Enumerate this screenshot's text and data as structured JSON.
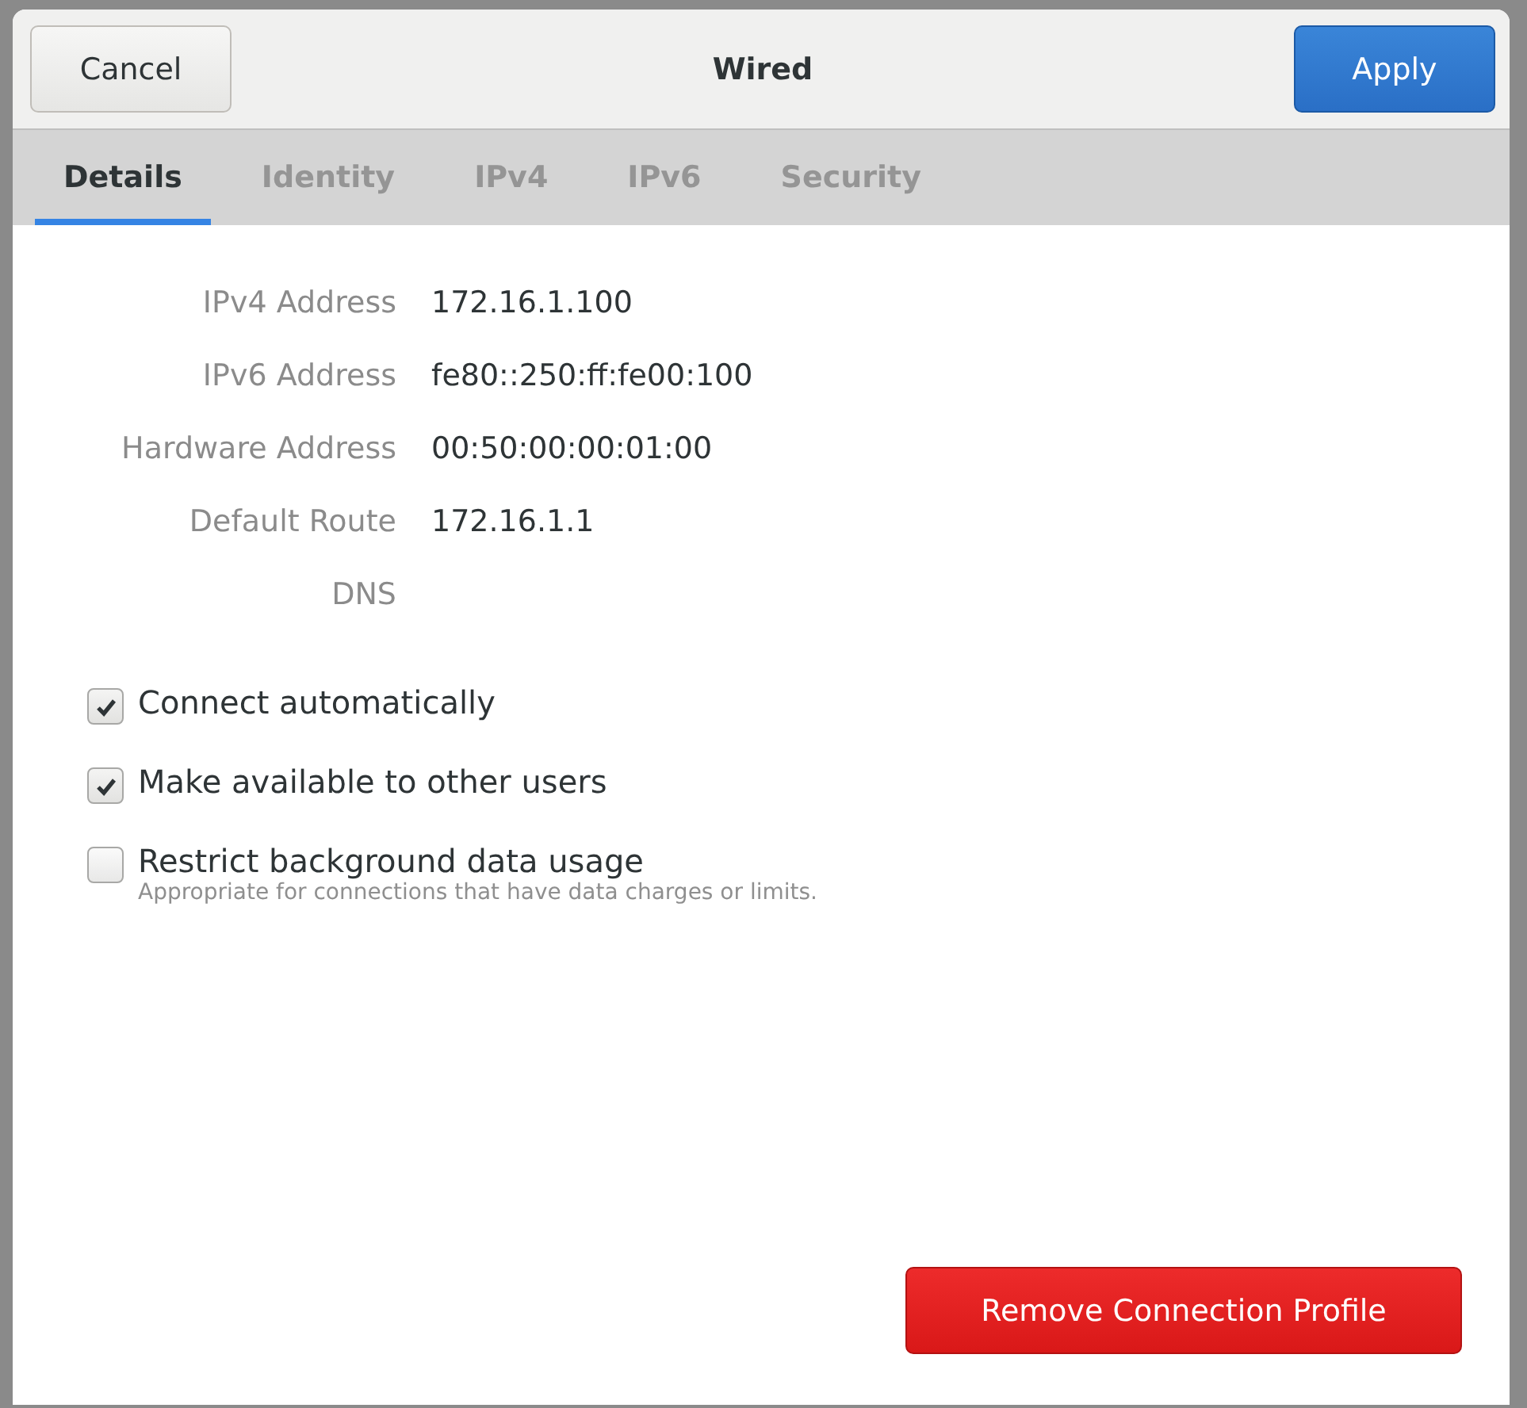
{
  "header": {
    "cancel": "Cancel",
    "title": "Wired",
    "apply": "Apply"
  },
  "tabs": [
    {
      "label": "Details",
      "selected": true
    },
    {
      "label": "Identity",
      "selected": false
    },
    {
      "label": "IPv4",
      "selected": false
    },
    {
      "label": "IPv6",
      "selected": false
    },
    {
      "label": "Security",
      "selected": false
    }
  ],
  "details": [
    {
      "label": "IPv4 Address",
      "value": "172.16.1.100"
    },
    {
      "label": "IPv6 Address",
      "value": "fe80::250:ff:fe00:100"
    },
    {
      "label": "Hardware Address",
      "value": "00:50:00:00:01:00"
    },
    {
      "label": "Default Route",
      "value": "172.16.1.1"
    },
    {
      "label": "DNS"
    }
  ],
  "options": [
    {
      "label": "Connect automatically",
      "checked": true
    },
    {
      "label": "Make available to other users",
      "checked": true
    },
    {
      "label": "Restrict background data usage",
      "checked": false,
      "hint": "Appropriate for connections that have data charges or limits."
    }
  ],
  "remove_button": "Remove Connection Profile"
}
